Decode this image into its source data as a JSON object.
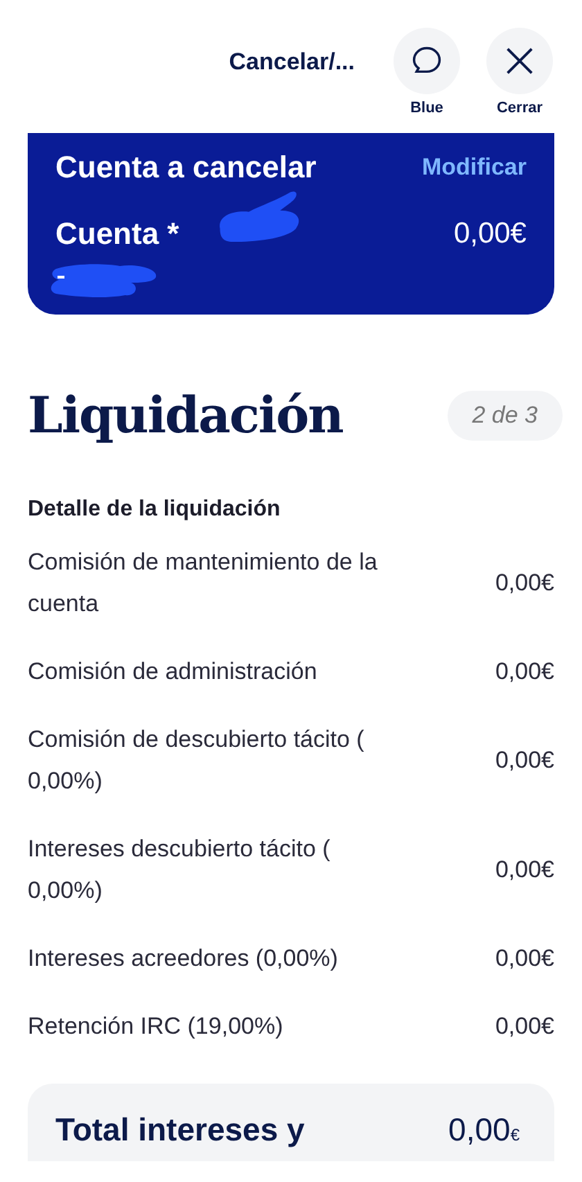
{
  "header": {
    "title": "Cancelar/...",
    "actions": [
      {
        "kind": "chat",
        "label": "Blue"
      },
      {
        "kind": "close",
        "label": "Cerrar"
      }
    ]
  },
  "account_card": {
    "title": "Cuenta a cancelar",
    "link": "Modificar",
    "account": "Cuenta *",
    "balance": "0,00€",
    "redacted": true
  },
  "section": {
    "title": "Liquidación",
    "step": "2 de 3"
  },
  "detail": {
    "title": "Detalle de la liquidación",
    "rows": [
      {
        "label": "Comisión de mantenimiento de la cuenta",
        "value": "0,00€"
      },
      {
        "label": "Comisión de administración",
        "value": "0,00€"
      },
      {
        "label": "Comisión de descubierto tácito ( 0,00%)",
        "value": "0,00€"
      },
      {
        "label": "Intereses descubierto tácito ( 0,00%)",
        "value": "0,00€"
      },
      {
        "label": "Intereses acreedores (0,00%)",
        "value": "0,00€"
      },
      {
        "label": "Retención IRC (19,00%)",
        "value": "0,00€"
      }
    ]
  },
  "total": {
    "label": "Total intereses y",
    "amount": "0,00",
    "currency": "€"
  }
}
